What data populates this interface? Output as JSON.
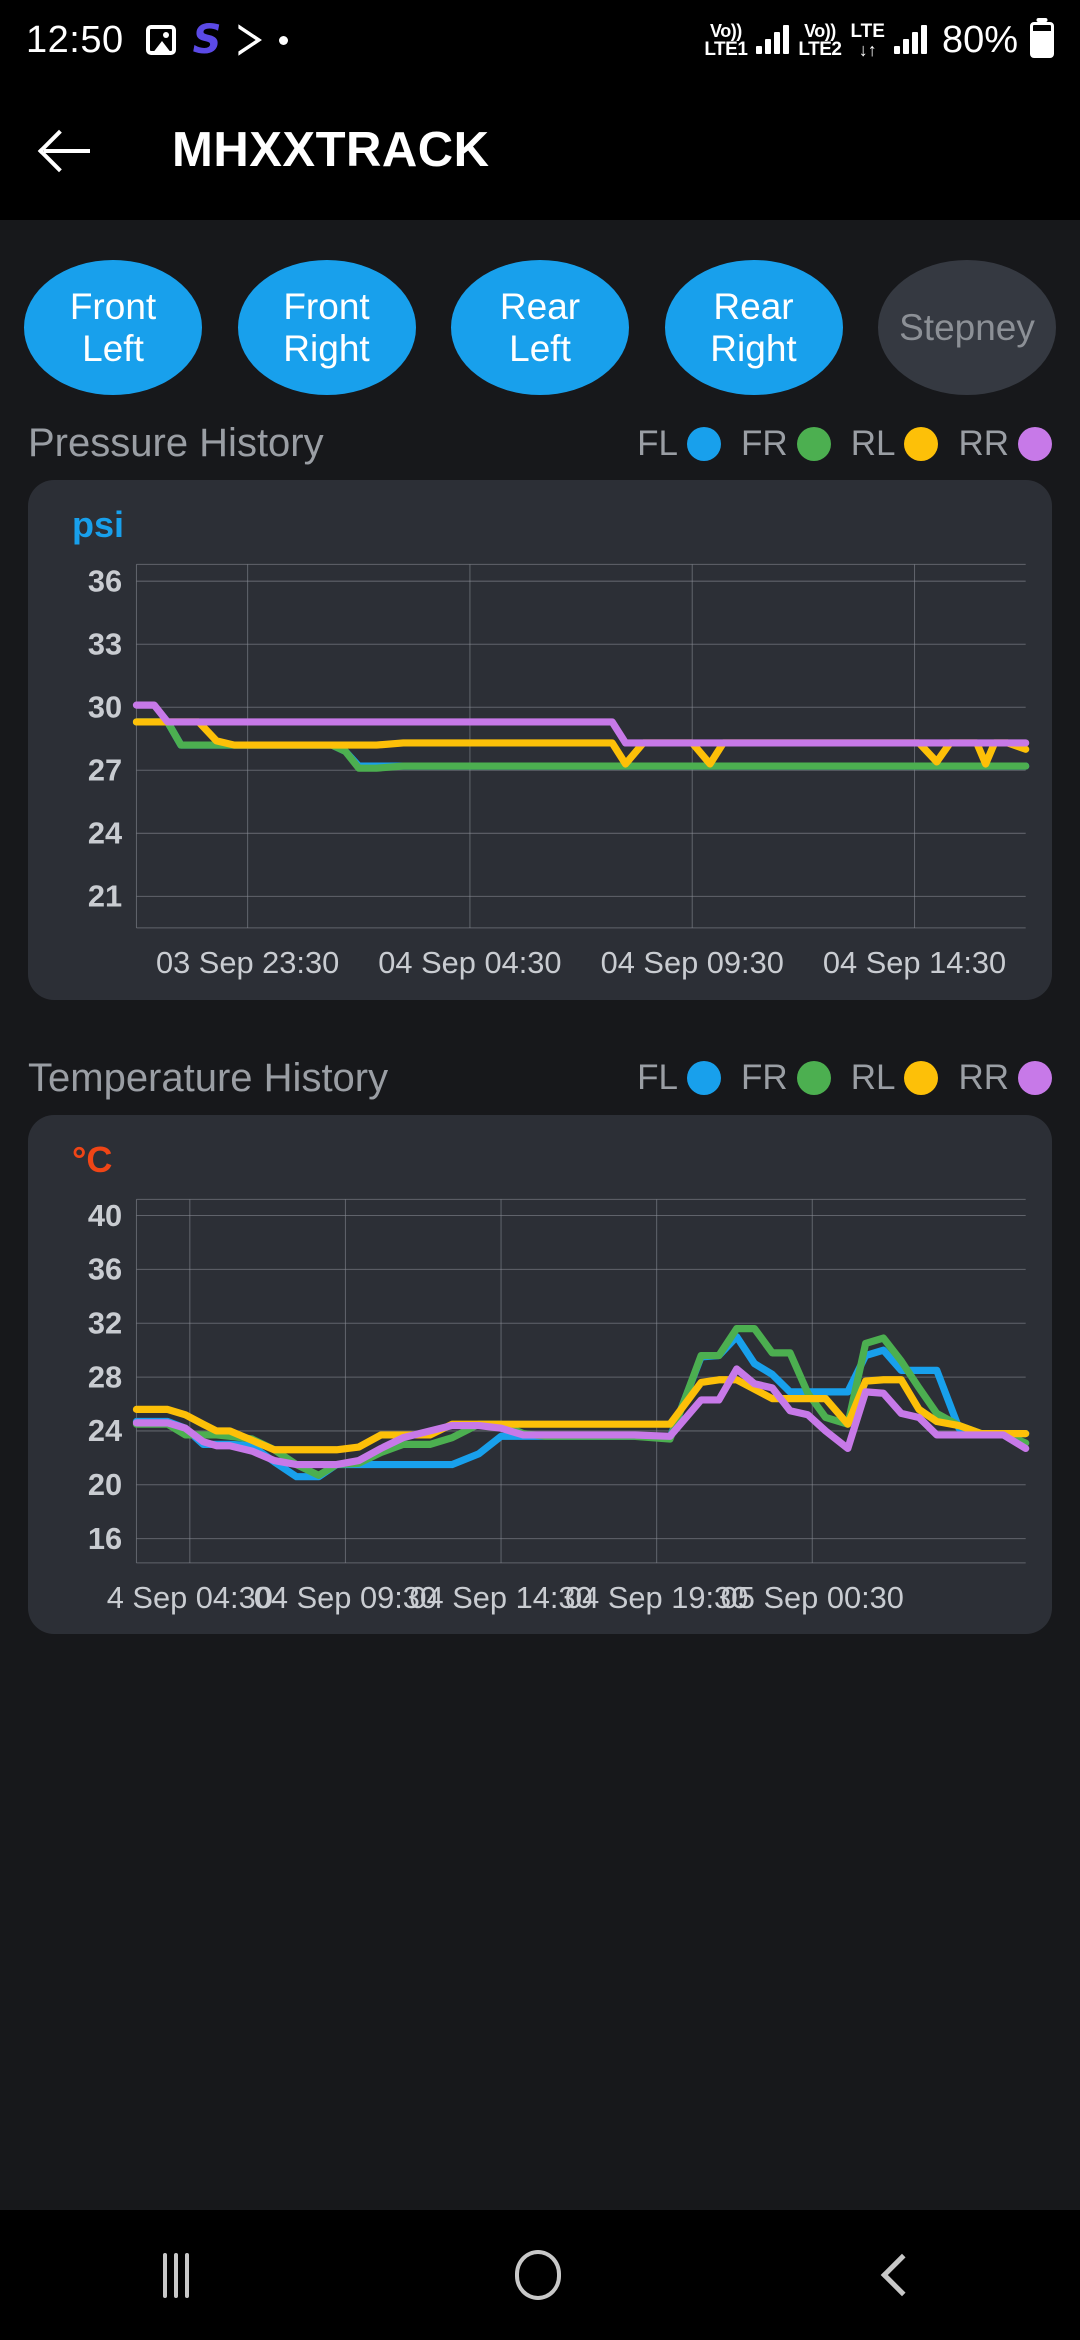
{
  "status_bar": {
    "clock": "12:50",
    "left_icons": [
      "gallery-icon",
      "samsung-internet-s-icon",
      "play-store-icon",
      "dot-icon"
    ],
    "sim1": {
      "volte": "Vo))",
      "network": "LTE1"
    },
    "sim2": {
      "volte": "Vo))",
      "network": "LTE2",
      "data": "LTE",
      "arrows": "↓↑"
    },
    "battery_percent": "80%"
  },
  "app_bar": {
    "back_label": "back-arrow",
    "title": "MHXXTRACK"
  },
  "chips": [
    {
      "line1": "Front",
      "line2": "Left",
      "state": "active"
    },
    {
      "line1": "Front",
      "line2": "Right",
      "state": "active"
    },
    {
      "line1": "Rear",
      "line2": "Left",
      "state": "active"
    },
    {
      "line1": "Rear",
      "line2": "Right",
      "state": "active"
    },
    {
      "line1": "Stepney",
      "line2": "",
      "state": "inactive"
    }
  ],
  "legend": [
    {
      "label": "FL",
      "color": "#18a0ec"
    },
    {
      "label": "FR",
      "color": "#4caf50"
    },
    {
      "label": "RL",
      "color": "#fdc008"
    },
    {
      "label": "RR",
      "color": "#c779e8"
    }
  ],
  "pressure_section": {
    "title": "Pressure History",
    "unit": "psi"
  },
  "temperature_section": {
    "title": "Temperature History",
    "unit": "°C"
  },
  "nav_bar": {
    "recents": "recents-icon",
    "home": "home-icon",
    "back": "back-icon"
  },
  "chart_data": [
    {
      "type": "line",
      "title": "Pressure History",
      "ylabel": "psi",
      "xlabel": "",
      "ylim": [
        19.5,
        36.8
      ],
      "yticks": [
        36,
        33,
        30,
        27,
        24,
        21
      ],
      "grid": true,
      "legend_position": "top-right",
      "xtick_labels": [
        "03 Sep 23:30",
        "04 Sep 04:30",
        "04 Sep 09:30",
        "04 Sep 14:30"
      ],
      "xtick_positions": [
        0.125,
        0.375,
        0.625,
        0.875
      ],
      "x": [
        0,
        0.02,
        0.035,
        0.05,
        0.07,
        0.09,
        0.11,
        0.16,
        0.2,
        0.22,
        0.235,
        0.25,
        0.27,
        0.3,
        0.33,
        0.36,
        0.4,
        0.45,
        0.5,
        0.535,
        0.55,
        0.57,
        0.6,
        0.625,
        0.645,
        0.66,
        0.7,
        0.8,
        0.88,
        0.9,
        0.915,
        0.93,
        0.945,
        0.955,
        0.965,
        0.98,
        1.0
      ],
      "series": [
        {
          "name": "FL",
          "color": "#18a0ec",
          "values": [
            29.3,
            29.3,
            29.3,
            28.2,
            28.2,
            28.2,
            28.2,
            28.2,
            28.2,
            28.2,
            27.9,
            27.2,
            27.2,
            27.2,
            27.2,
            27.2,
            27.2,
            27.2,
            27.2,
            27.2,
            27.2,
            27.2,
            27.2,
            27.2,
            27.2,
            27.2,
            27.2,
            27.2,
            27.2,
            27.2,
            27.2,
            27.2,
            27.2,
            27.2,
            27.2,
            27.2,
            27.2
          ]
        },
        {
          "name": "FR",
          "color": "#4caf50",
          "values": [
            29.3,
            29.3,
            29.3,
            28.2,
            28.2,
            28.2,
            28.2,
            28.2,
            28.2,
            28.2,
            27.9,
            27.1,
            27.1,
            27.2,
            27.2,
            27.2,
            27.2,
            27.2,
            27.2,
            27.2,
            27.2,
            27.2,
            27.2,
            27.2,
            27.2,
            27.2,
            27.2,
            27.2,
            27.2,
            27.2,
            27.2,
            27.2,
            27.2,
            27.2,
            27.2,
            27.2,
            27.2
          ]
        },
        {
          "name": "RL",
          "color": "#fdc008",
          "values": [
            29.3,
            29.3,
            29.3,
            29.3,
            29.3,
            28.4,
            28.2,
            28.2,
            28.2,
            28.2,
            28.2,
            28.2,
            28.2,
            28.3,
            28.3,
            28.3,
            28.3,
            28.3,
            28.3,
            28.3,
            27.3,
            28.3,
            28.3,
            28.3,
            27.3,
            28.3,
            28.3,
            28.3,
            28.3,
            27.4,
            28.3,
            28.3,
            28.3,
            27.3,
            28.3,
            28.3,
            28.0
          ]
        },
        {
          "name": "RR",
          "color": "#c779e8",
          "values": [
            30.1,
            30.1,
            29.3,
            29.3,
            29.3,
            29.3,
            29.3,
            29.3,
            29.3,
            29.3,
            29.3,
            29.3,
            29.3,
            29.3,
            29.3,
            29.3,
            29.3,
            29.3,
            29.3,
            29.3,
            28.3,
            28.3,
            28.3,
            28.3,
            28.3,
            28.3,
            28.3,
            28.3,
            28.3,
            28.3,
            28.3,
            28.3,
            28.3,
            28.3,
            28.3,
            28.3,
            28.3
          ]
        }
      ]
    },
    {
      "type": "line",
      "title": "Temperature History",
      "ylabel": "°C",
      "xlabel": "",
      "ylim": [
        14.2,
        41.2
      ],
      "yticks": [
        40,
        36,
        32,
        28,
        24,
        20,
        16
      ],
      "grid": true,
      "legend_position": "top-right",
      "xtick_labels": [
        "4 Sep 04:30",
        "04 Sep 09:30",
        "04 Sep 14:30",
        "04 Sep 19:30",
        "05 Sep 00:30"
      ],
      "xtick_positions": [
        0.06,
        0.235,
        0.41,
        0.585,
        0.76
      ],
      "x": [
        0,
        0.035,
        0.055,
        0.075,
        0.09,
        0.105,
        0.13,
        0.155,
        0.18,
        0.205,
        0.225,
        0.25,
        0.275,
        0.3,
        0.33,
        0.355,
        0.385,
        0.41,
        0.435,
        0.46,
        0.49,
        0.52,
        0.56,
        0.6,
        0.635,
        0.655,
        0.675,
        0.695,
        0.715,
        0.735,
        0.755,
        0.775,
        0.8,
        0.82,
        0.84,
        0.86,
        0.88,
        0.9,
        0.925,
        0.95,
        0.975,
        1.0
      ],
      "series": [
        {
          "name": "FL",
          "color": "#18a0ec",
          "values": [
            24.7,
            24.7,
            24.2,
            23.0,
            23.0,
            23.0,
            22.9,
            21.7,
            20.6,
            20.6,
            21.5,
            21.5,
            21.5,
            21.5,
            21.5,
            21.5,
            22.3,
            23.6,
            23.6,
            23.6,
            23.6,
            23.6,
            23.6,
            23.5,
            29.5,
            29.6,
            31.0,
            29.0,
            28.2,
            26.9,
            26.9,
            26.9,
            26.9,
            29.6,
            30.0,
            28.5,
            28.5,
            28.5,
            24.2,
            23.8,
            23.8,
            23.8
          ]
        },
        {
          "name": "FR",
          "color": "#4caf50",
          "values": [
            24.5,
            24.5,
            23.7,
            23.7,
            23.7,
            23.6,
            23.4,
            22.6,
            21.5,
            20.7,
            21.5,
            21.6,
            22.4,
            23.0,
            23.0,
            23.5,
            24.5,
            24.5,
            23.8,
            23.6,
            23.6,
            23.6,
            23.6,
            23.4,
            29.6,
            29.6,
            31.6,
            31.6,
            29.8,
            29.8,
            26.8,
            25.0,
            24.5,
            30.5,
            30.9,
            29.2,
            27.2,
            25.3,
            24.4,
            23.8,
            23.8,
            23.1
          ]
        },
        {
          "name": "RL",
          "color": "#fdc008",
          "values": [
            25.6,
            25.6,
            25.2,
            24.5,
            24.0,
            24.0,
            23.3,
            22.6,
            22.6,
            22.6,
            22.6,
            22.8,
            23.7,
            23.7,
            23.7,
            24.5,
            24.5,
            24.5,
            24.5,
            24.5,
            24.5,
            24.5,
            24.5,
            24.5,
            27.6,
            27.8,
            27.8,
            27.1,
            26.4,
            26.4,
            26.4,
            26.4,
            24.5,
            27.7,
            27.8,
            27.8,
            25.6,
            24.7,
            24.4,
            23.8,
            23.8,
            23.8
          ]
        },
        {
          "name": "RR",
          "color": "#c779e8",
          "values": [
            24.6,
            24.6,
            24.2,
            23.2,
            22.9,
            22.9,
            22.5,
            21.8,
            21.5,
            21.5,
            21.5,
            21.8,
            22.7,
            23.5,
            24.0,
            24.4,
            24.4,
            24.2,
            23.7,
            23.7,
            23.7,
            23.7,
            23.7,
            23.6,
            26.3,
            26.3,
            28.6,
            27.5,
            27.2,
            25.5,
            25.2,
            24.0,
            22.7,
            26.9,
            26.8,
            25.3,
            25.0,
            23.7,
            23.7,
            23.7,
            23.7,
            22.7
          ]
        }
      ]
    }
  ]
}
